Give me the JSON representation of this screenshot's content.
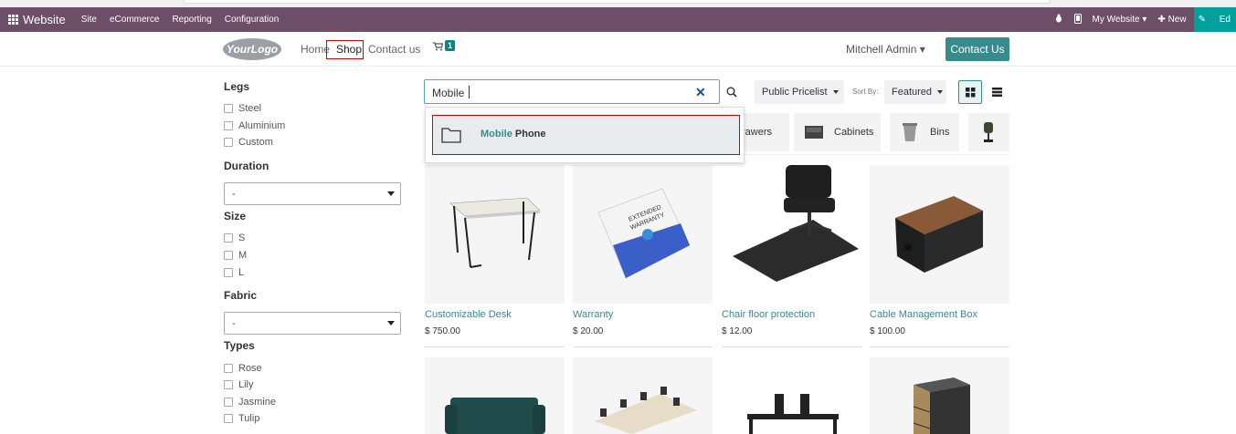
{
  "adminbar": {
    "brand": "Website",
    "menus": [
      "Site",
      "eCommerce",
      "Reporting",
      "Configuration"
    ],
    "right": {
      "my_website": "My Website",
      "new": "New",
      "edit": "Ed"
    }
  },
  "nav": {
    "logo": "YourLogo",
    "links": [
      "Home",
      "Shop",
      "Contact us"
    ],
    "cart_count": "1",
    "user": "Mitchell Admin",
    "contact_button": "Contact Us"
  },
  "filters": {
    "legs": {
      "title": "Legs",
      "options": [
        "Steel",
        "Aluminium",
        "Custom"
      ]
    },
    "duration": {
      "title": "Duration",
      "selected": "-"
    },
    "size": {
      "title": "Size",
      "options": [
        "S",
        "M",
        "L"
      ]
    },
    "fabric": {
      "title": "Fabric",
      "selected": "-"
    },
    "types": {
      "title": "Types",
      "options": [
        "Rose",
        "Lily",
        "Jasmine",
        "Tulip"
      ]
    }
  },
  "toolbar": {
    "search_value": "Mobile",
    "pricelist": "Public Pricelist",
    "sort_label": "Sort By:",
    "sort_value": "Featured"
  },
  "dropdown": {
    "highlight": "Mobile",
    "rest": " Phone"
  },
  "categories": [
    "rawers",
    "Cabinets",
    "Bins"
  ],
  "products": [
    {
      "name": "Customizable Desk",
      "price": "$ 750.00"
    },
    {
      "name": "Warranty",
      "price": "$ 20.00"
    },
    {
      "name": "Chair floor protection",
      "price": "$ 12.00"
    },
    {
      "name": "Cable Management Box",
      "price": "$ 100.00"
    }
  ],
  "colors": {
    "adminbar": "#6c4e66",
    "accent": "#378b8c",
    "highlight_box": "#dd0000"
  }
}
